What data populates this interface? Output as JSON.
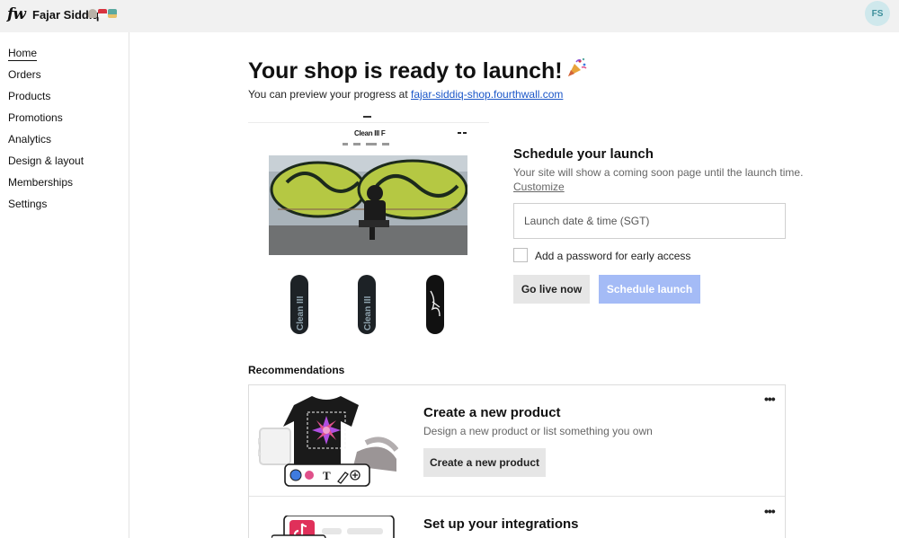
{
  "header": {
    "logo": "fw",
    "store_name": "Fajar Siddiq",
    "avatar_initials": "FS",
    "flag_colors": [
      "#b9b2a8",
      "#d8333f",
      "#5aa9a0"
    ]
  },
  "sidebar": {
    "items": [
      {
        "label": "Home",
        "active": true
      },
      {
        "label": "Orders"
      },
      {
        "label": "Products"
      },
      {
        "label": "Promotions"
      },
      {
        "label": "Analytics"
      },
      {
        "label": "Design & layout"
      },
      {
        "label": "Memberships"
      },
      {
        "label": "Settings"
      }
    ]
  },
  "main": {
    "title": "Your shop is ready to launch!",
    "title_emoji": "party-popper-icon",
    "subtitle_prefix": "You can preview your progress at",
    "site_link": "fajar-siddiq-shop.fourthwall.com"
  },
  "preview": {
    "brand": "Clean III F"
  },
  "schedule": {
    "title": "Schedule your launch",
    "description": "Your site will show a coming soon page until the launch time.",
    "customize_link": "Customize",
    "date_placeholder": "Launch date & time (SGT)",
    "password_label": "Add a password for early access",
    "go_live_label": "Go live now",
    "schedule_label": "Schedule launch",
    "accent_color": "#a4bbf6"
  },
  "recommendations": {
    "heading": "Recommendations",
    "items": [
      {
        "title": "Create a new product",
        "description": "Design a new product or list something you own",
        "button": "Create a new product"
      },
      {
        "title": "Set up your integrations"
      }
    ]
  }
}
